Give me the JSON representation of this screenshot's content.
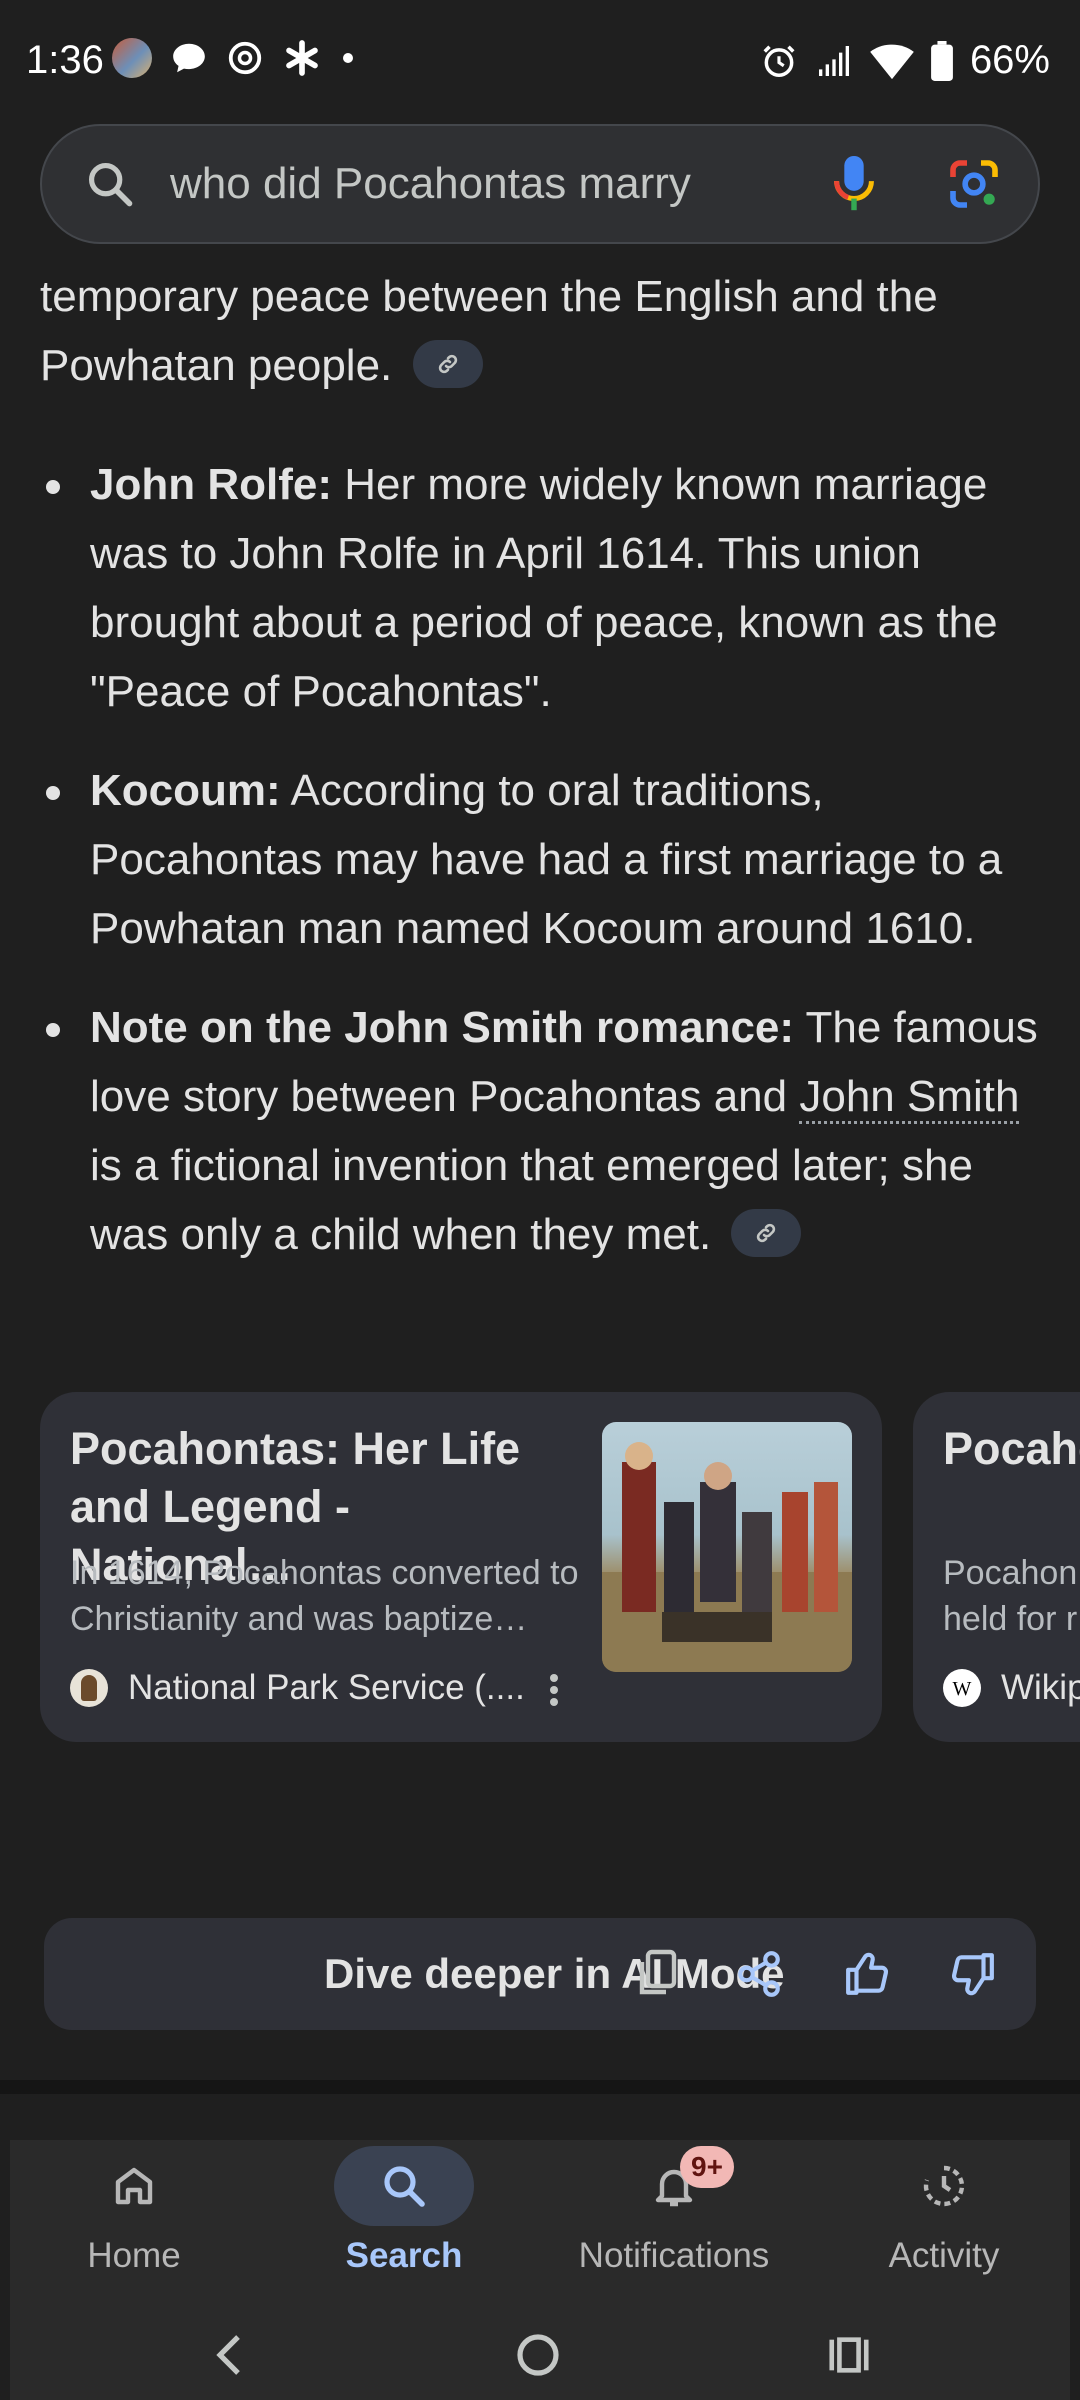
{
  "status_bar": {
    "time": "1:36",
    "battery": "66%",
    "icons_left": [
      "avatar-icon",
      "chat-bubble-icon",
      "threads-icon",
      "asterisk-icon",
      "dot-icon"
    ],
    "icons_right": [
      "alarm-icon",
      "signal-icon",
      "wifi-icon",
      "battery-icon"
    ]
  },
  "search": {
    "query": "who did Pocahontas marry"
  },
  "answer": {
    "intro_text": "temporary peace between the English and the Powhatan people.",
    "bullets": [
      {
        "bold": "John Rolfe:",
        "text": " Her more widely known marriage was to John Rolfe in April 1614. This union brought about a period of peace, known as the \"Peace of Pocahontas\"."
      },
      {
        "bold": "Kocoum:",
        "text": " According to oral traditions, Pocahontas may have had a first marriage to a Powhatan man named Kocoum around 1610."
      },
      {
        "bold": "Note on the John Smith romance:",
        "text_before": " The famous love story between Pocahontas and ",
        "link": "John Smith",
        "text_after": " is a fictional invention that emerged later; she was only a child when they met."
      }
    ]
  },
  "cards": [
    {
      "title": "Pocahontas: Her Life and Legend - National…",
      "snippet": "In 1614, Pocahontas converted to Christianity and was baptize…",
      "source": "National Park Service (...."
    },
    {
      "title": "Pocaho",
      "snippet": "Pocahon held for r",
      "snippet_line1": "Pocahon",
      "snippet_line2": "held for r",
      "source": "Wikip"
    }
  ],
  "ai_mode": {
    "label": "Dive deeper in AI Mode"
  },
  "bottom_nav": {
    "items": [
      {
        "label": "Home"
      },
      {
        "label": "Search"
      },
      {
        "label": "Notifications",
        "badge": "9+"
      },
      {
        "label": "Activity"
      }
    ],
    "active": "Search"
  },
  "colors": {
    "background": "#1f1f1f",
    "accent": "#a8c7fa",
    "card": "#2f3037"
  }
}
